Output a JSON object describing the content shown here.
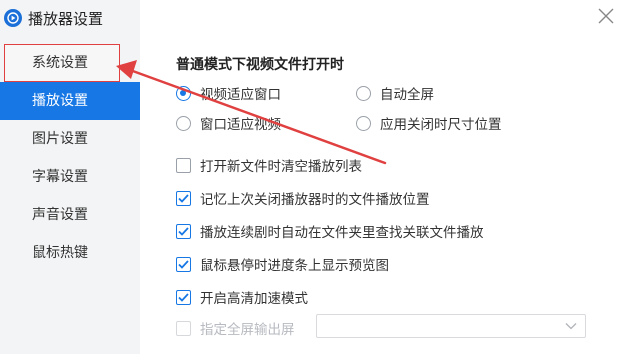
{
  "app": {
    "title": "播放器设置",
    "logo_icon": "player-logo-icon",
    "accent_color": "#1677e5"
  },
  "sidebar": {
    "items": [
      {
        "label": "系统设置",
        "state": "highlighted"
      },
      {
        "label": "播放设置",
        "state": "active"
      },
      {
        "label": "图片设置",
        "state": "normal"
      },
      {
        "label": "字幕设置",
        "state": "normal"
      },
      {
        "label": "声音设置",
        "state": "normal"
      },
      {
        "label": "鼠标热键",
        "state": "normal"
      }
    ]
  },
  "content": {
    "section_title": "普通模式下视频文件打开时",
    "radios": [
      {
        "label": "视频适应窗口",
        "checked": true
      },
      {
        "label": "自动全屏",
        "checked": false
      },
      {
        "label": "窗口适应视频",
        "checked": false
      },
      {
        "label": "应用关闭时尺寸位置",
        "checked": false
      }
    ],
    "checkboxes": [
      {
        "label": "打开新文件时清空播放列表",
        "checked": false
      },
      {
        "label": "记忆上次关闭播放器时的文件播放位置",
        "checked": true
      },
      {
        "label": "播放连续剧时自动在文件夹里查找关联文件播放",
        "checked": true
      },
      {
        "label": "鼠标悬停时进度条上显示预览图",
        "checked": true
      },
      {
        "label": "开启高清加速模式",
        "checked": true
      }
    ],
    "fullscreen_output": {
      "label": "指定全屏输出屏",
      "checked": false,
      "disabled": true,
      "selected_value": ""
    }
  },
  "annotation": {
    "arrow_color": "#e04040",
    "box_color": "#e04040"
  }
}
